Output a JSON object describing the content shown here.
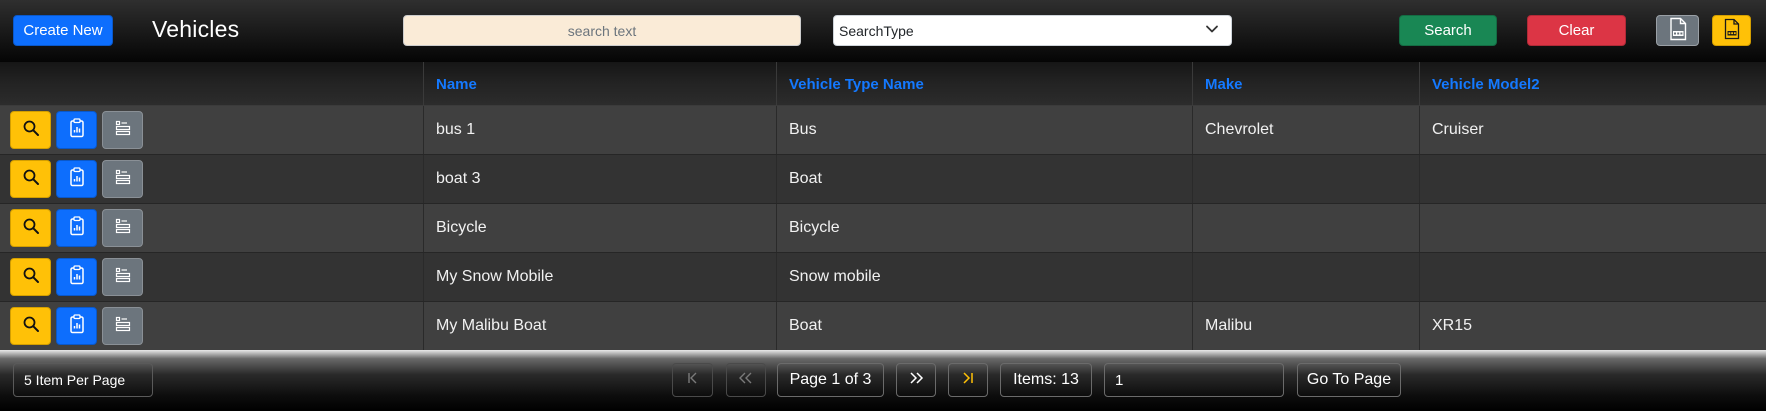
{
  "toolbar": {
    "create_label": "Create New",
    "title": "Vehicles",
    "search_placeholder": "search text",
    "search_value": "",
    "search_type_value": "SearchType",
    "search_label": "Search",
    "clear_label": "Clear",
    "csv_icon": "csv-file-icon",
    "pdf_icon": "pdf-file-icon"
  },
  "table": {
    "columns": [
      "",
      "Name",
      "Vehicle Type Name",
      "Make",
      "Vehicle Model2"
    ],
    "rows": [
      {
        "name": "bus 1",
        "type": "Bus",
        "make": "Chevrolet",
        "model": "Cruiser"
      },
      {
        "name": "boat 3",
        "type": "Boat",
        "make": "",
        "model": ""
      },
      {
        "name": "Bicycle",
        "type": "Bicycle",
        "make": "",
        "model": ""
      },
      {
        "name": "My Snow Mobile",
        "type": "Snow mobile",
        "make": "",
        "model": ""
      },
      {
        "name": "My Malibu Boat",
        "type": "Boat",
        "make": "Malibu",
        "model": "XR15"
      }
    ],
    "row_actions": [
      "search-icon",
      "clipboard-icon",
      "details-list-icon"
    ]
  },
  "pagination": {
    "per_page": "5 Item Per Page",
    "page_info": "Page 1 of 3",
    "items_info": "Items: 13",
    "goto_value": "1",
    "goto_label": "Go To Page"
  },
  "colors": {
    "accent_blue": "#0d6efd",
    "header_text": "#1479ff",
    "search_green": "#198754",
    "clear_red": "#dc3545",
    "warning_yellow": "#ffc107",
    "secondary_gray": "#6c757d",
    "search_bg": "#faebd7"
  }
}
